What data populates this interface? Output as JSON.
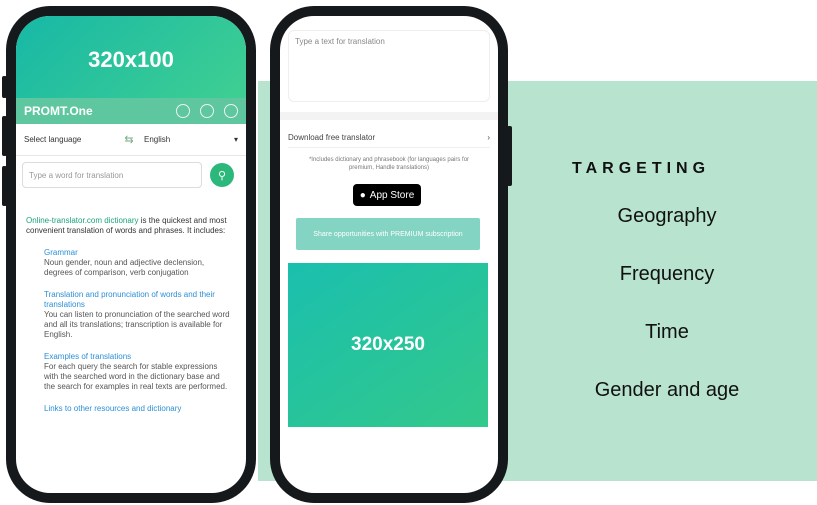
{
  "phone1": {
    "ad_banner_label": "320x100",
    "app_logo": "PROMT.One",
    "source_language": "Select language",
    "target_language": "English",
    "search_placeholder": "Type a word for translation",
    "intro_link": "Online-translator.com dictionary",
    "intro_text": " is the quickest and most convenient translation of words and phrases. It includes:",
    "sections": [
      {
        "heading": "Grammar",
        "text": "Noun gender, noun and adjective declension, degrees of comparison, verb conjugation"
      },
      {
        "heading": "Translation and pronunciation of words and their translations",
        "text": "You can listen to pronunciation of the searched word and all its translations; transcription is available for English."
      },
      {
        "heading": "Examples of translations",
        "text": "For each query the search for stable expressions with the searched word in the dictionary base and the search for examples in real texts are performed."
      },
      {
        "heading": "Links to other resources and dictionary",
        "text": ""
      }
    ]
  },
  "phone2": {
    "text_placeholder": "Type a text for translation",
    "download_label": "Download free translator",
    "offline_note": "*Includes dictionary and phrasebook (for languages pairs for premium, Handle translations)",
    "app_store_label": "App Store",
    "premium_button": "Share opportunities with PREMIUM subscription",
    "ad_banner_label": "320x250"
  },
  "targeting": {
    "title": "TARGETING",
    "items": [
      "Geography",
      "Frequency",
      "Time",
      "Gender and age"
    ]
  },
  "colors": {
    "mint_panel": "#b7e3cf",
    "banner_gradient_start": "#17b8a6",
    "banner_gradient_end": "#3fcf92",
    "phone_frame": "#16191c"
  }
}
